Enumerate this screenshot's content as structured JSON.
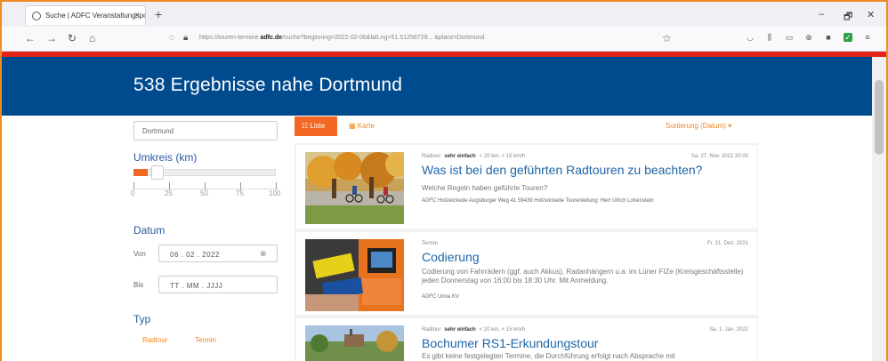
{
  "browser": {
    "tab_title": "Suche | ADFC Veranstaltungspo",
    "tab_close": "×",
    "new_tab": "+",
    "url_prefix": "https://touren-termine.",
    "url_domain": "adfc.de",
    "url_path": "/suche?beginning=2022-02-06&latLng=51.51258729... &place=Dortmund",
    "controls": {
      "minimize": "–",
      "maximize": "🗗",
      "close": "✕"
    }
  },
  "header": {
    "title": "538 Ergebnisse nahe Dortmund"
  },
  "sidebar": {
    "place_value": "Dortmund",
    "radius_label": "Umkreis (km)",
    "radius_km": 10,
    "radius_ticks": [
      "0",
      "25",
      "50",
      "75",
      "100"
    ],
    "date_label": "Datum",
    "from_label": "Von",
    "from_value": "06 . 02 . 2022",
    "to_label": "Bis",
    "to_placeholder": "TT . MM . JJJJ",
    "type_label": "Typ",
    "type_options": [
      "Radtour",
      "Termin"
    ]
  },
  "toolbar": {
    "list_label": "☷ Liste",
    "map_label": "▦ Karte",
    "sort_label": "Sortierung (Datum) ▾"
  },
  "results": [
    {
      "kind": "Radtour",
      "difficulty": "sehr einfach",
      "stats": "< 20 km, < 15 km/h",
      "date": "Sa. 27. Nov. 2021 20:00",
      "title": "Was ist bei den geführten Radtouren zu beachten?",
      "description": "Welche Regeln haben geführte Touren?",
      "organizer": "ADFC Holzwickede Augsburger Weg 41 59439 Holzwickede Tourenleitung: Herr Ulrich Lohenstein"
    },
    {
      "kind": "Termin",
      "date": "Fr. 31. Dez. 2021",
      "title": "Codierung",
      "description": "Codierung von Fahrrädern (ggf. auch Akkus), Radanhängern u.a. im Lüner FIZe (Kreisgeschäftsstelle) jeden Donnerstag von 16:00 bis 18:30 Uhr. Mit Anmeldung.",
      "organizer": "ADFC Unna KV"
    },
    {
      "kind": "Radtour",
      "difficulty": "sehr einfach",
      "stats": "< 20 km, < 15 km/h",
      "date": "Sa. 1. Jan. 2022",
      "title": "Bochumer RS1-Erkundungstour",
      "description": "Es gibt keine festgelegten Termine, die Durchführung erfolgt nach Absprache mit"
    }
  ]
}
